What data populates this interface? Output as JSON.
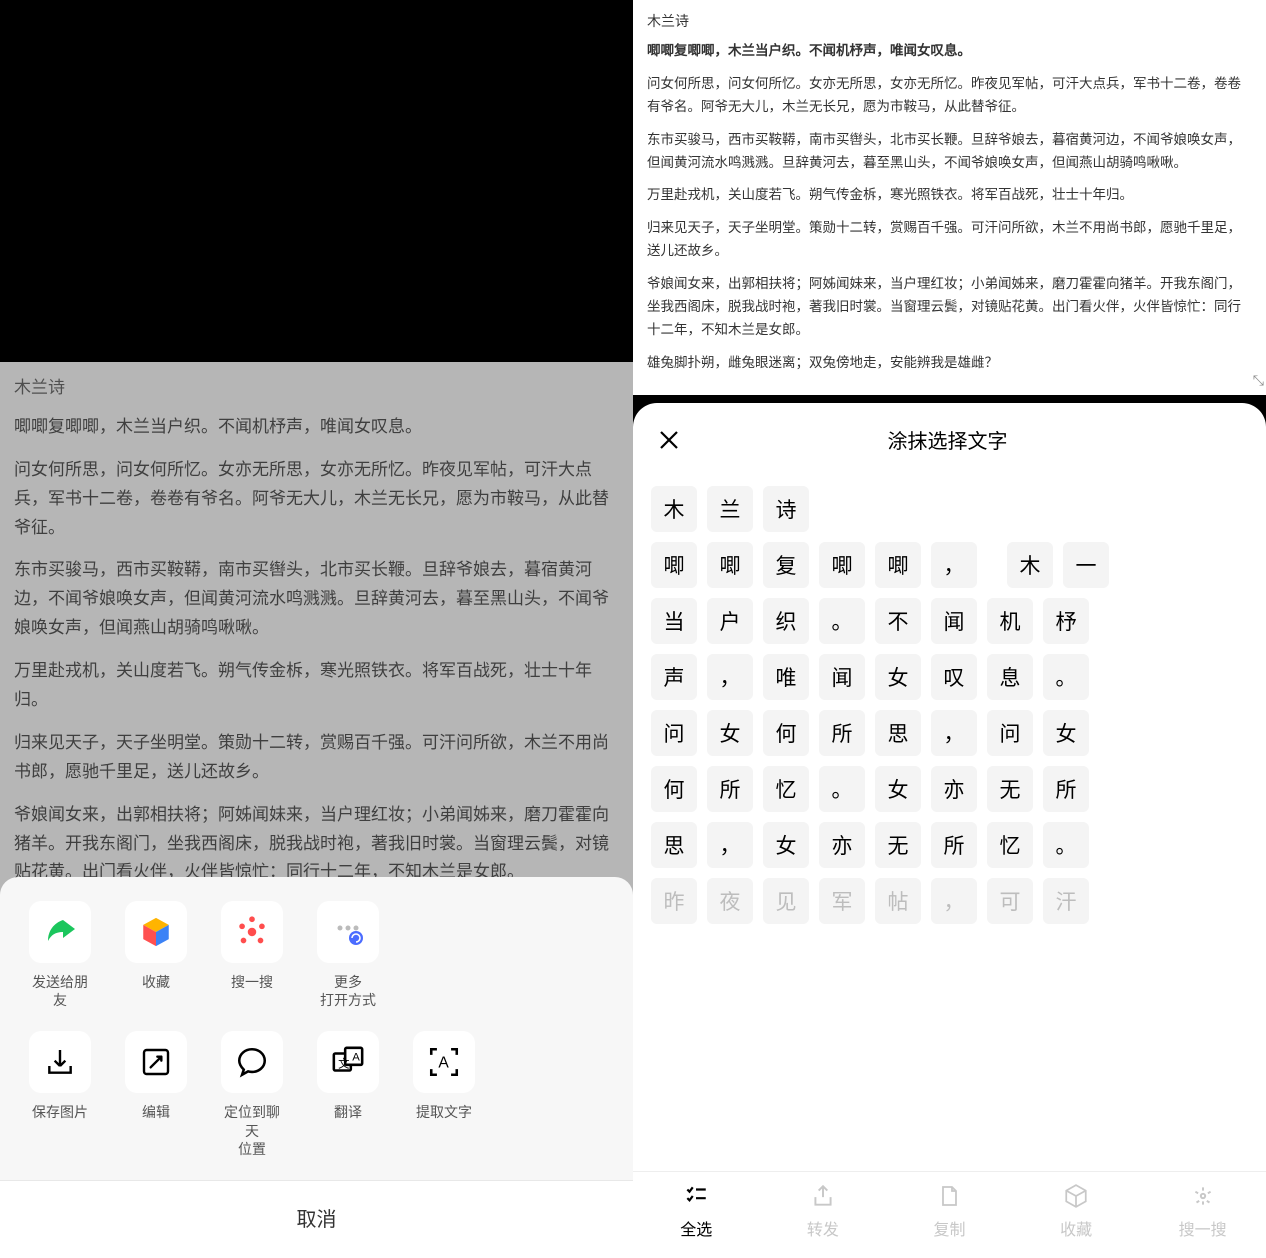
{
  "doc": {
    "title": "木兰诗",
    "paragraphs": [
      {
        "text": "唧唧复唧唧，木兰当户织。不闻机杼声，唯闻女叹息。",
        "bold": true
      },
      {
        "text": "问女何所思，问女何所忆。女亦无所思，女亦无所忆。昨夜见军帖，可汗大点兵，军书十二卷，卷卷有爷名。阿爷无大儿，木兰无长兄，愿为市鞍马，从此替爷征。"
      },
      {
        "text": "东市买骏马，西市买鞍鞯，南市买辔头，北市买长鞭。旦辞爷娘去，暮宿黄河边，不闻爷娘唤女声，但闻黄河流水鸣溅溅。旦辞黄河去，暮至黑山头，不闻爷娘唤女声，但闻燕山胡骑鸣啾啾。"
      },
      {
        "text": "万里赴戎机，关山度若飞。朔气传金柝，寒光照铁衣。将军百战死，壮士十年归。"
      },
      {
        "text": "归来见天子，天子坐明堂。策勋十二转，赏赐百千强。可汗问所欲，木兰不用尚书郎，愿驰千里足，送儿还故乡。"
      },
      {
        "text": "爷娘闻女来，出郭相扶将；阿姊闻妹来，当户理红妆；小弟闻姊来，磨刀霍霍向猪羊。开我东阁门，坐我西阁床，脱我战时袍，著我旧时裳。当窗理云鬓，对镜贴花黄。出门看火伴，火伴皆惊忙：同行十二年，不知木兰是女郎。"
      },
      {
        "text": "雄兔脚扑朔，雌兔眼迷离；双兔傍地走，安能辨我是雄雌？"
      }
    ]
  },
  "share": {
    "row1": [
      {
        "name": "send-to-friend",
        "label": "发送给朋友",
        "icon": "share-arrow",
        "color": "#1bc65d"
      },
      {
        "name": "favorite",
        "label": "收藏",
        "icon": "cube",
        "color": "#ffb400"
      },
      {
        "name": "sou-yi-sou",
        "label": "搜一搜",
        "icon": "spark",
        "color": "#ff4d4d"
      },
      {
        "name": "more-open-with",
        "label": "更多\n打开方式",
        "icon": "dots-badge",
        "color": "#888"
      }
    ],
    "row2": [
      {
        "name": "save-image",
        "label": "保存图片",
        "icon": "download"
      },
      {
        "name": "edit",
        "label": "编辑",
        "icon": "edit"
      },
      {
        "name": "locate-chat",
        "label": "定位到聊天\n位置",
        "icon": "chat-bubble"
      },
      {
        "name": "translate",
        "label": "翻译",
        "icon": "translate"
      },
      {
        "name": "extract-text",
        "label": "提取文字",
        "icon": "ocr"
      }
    ],
    "cancel": "取消"
  },
  "textPanel": {
    "title": "涂抹选择文字",
    "grid": [
      [
        "木",
        "兰",
        "诗"
      ],
      [
        "唧",
        "唧",
        "复",
        "唧",
        "唧",
        "，",
        "",
        "木",
        "一"
      ],
      [
        "当",
        "户",
        "织",
        "。",
        "不",
        "闻",
        "机",
        "杼"
      ],
      [
        "声",
        "，",
        "唯",
        "闻",
        "女",
        "叹",
        "息",
        "。"
      ],
      [
        "问",
        "女",
        "何",
        "所",
        "思",
        "，",
        "问",
        "女"
      ],
      [
        "何",
        "所",
        "忆",
        "。",
        "女",
        "亦",
        "无",
        "所"
      ],
      [
        "思",
        "，",
        "女",
        "亦",
        "无",
        "所",
        "忆",
        "。"
      ],
      [
        "昨",
        "夜",
        "见",
        "军",
        "帖",
        "，",
        "可",
        "汗"
      ]
    ],
    "fadedRowIndex": 7,
    "bottomBar": [
      {
        "name": "select-all",
        "label": "全选",
        "icon": "list-check",
        "active": true
      },
      {
        "name": "forward",
        "label": "转发",
        "icon": "share-up",
        "active": false
      },
      {
        "name": "copy",
        "label": "复制",
        "icon": "doc",
        "active": false
      },
      {
        "name": "collect",
        "label": "收藏",
        "icon": "cube-outline",
        "active": false
      },
      {
        "name": "search",
        "label": "搜一搜",
        "icon": "spark-outline",
        "active": false
      }
    ]
  }
}
